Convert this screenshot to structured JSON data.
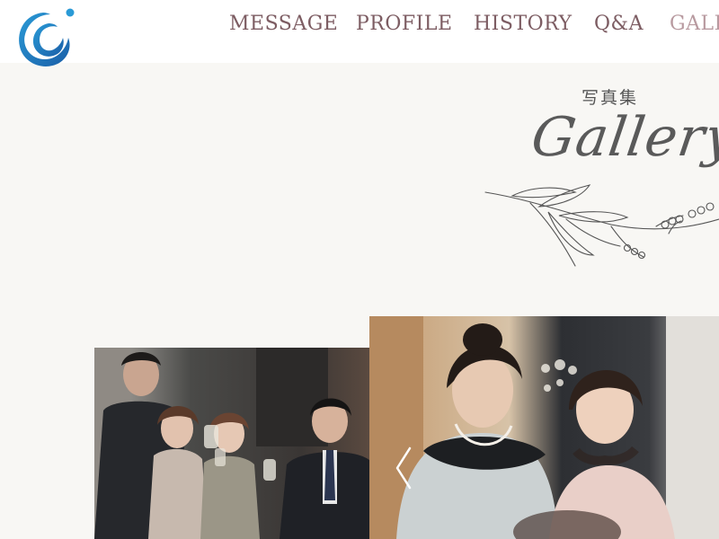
{
  "nav": {
    "items": [
      "MESSAGE",
      "PROFILE",
      "HISTORY",
      "Q&A",
      "GALL"
    ]
  },
  "gallery": {
    "subtitle": "写真集",
    "title": "Gallery"
  },
  "colors": {
    "nav_text": "#7d5d63",
    "nav_active": "#b89aa0",
    "logo_blue": "#1a6fb8",
    "logo_light_blue": "#2a9ad6",
    "background": "#f8f7f4"
  },
  "icons": {
    "logo": "swirl-logo-icon",
    "carousel_prev": "chevron-left-icon"
  }
}
